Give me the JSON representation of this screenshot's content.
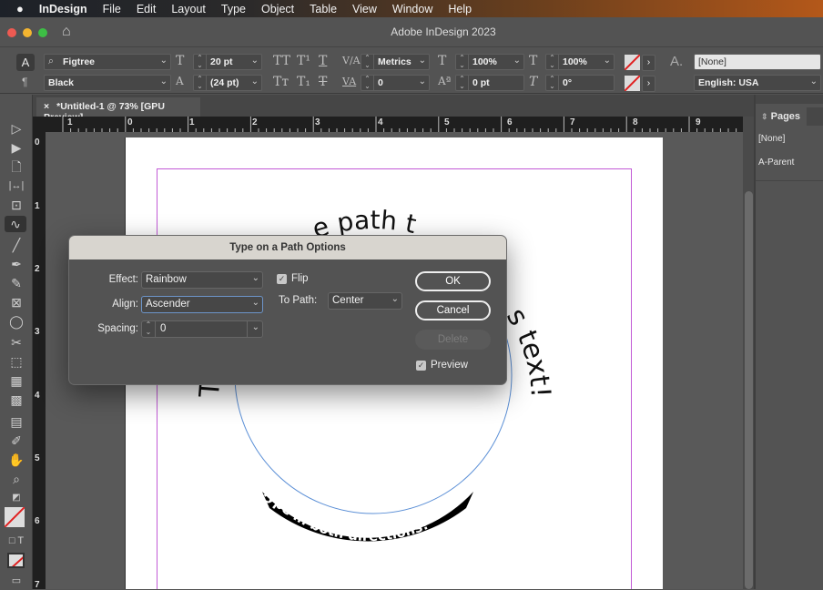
{
  "menubar": {
    "apple": "",
    "app": "InDesign",
    "items": [
      "File",
      "Edit",
      "Layout",
      "Type",
      "Object",
      "Table",
      "View",
      "Window",
      "Help"
    ]
  },
  "window": {
    "title": "Adobe InDesign 2023"
  },
  "control": {
    "font_family": "Figtree",
    "font_style": "Black",
    "font_size": "20 pt",
    "leading": "(24 pt)",
    "kerning": "Metrics",
    "tracking": "0",
    "vertical_scale": "100%",
    "horizontal_scale": "100%",
    "baseline_shift": "0 pt",
    "skew": "0°",
    "char_style": "[None]",
    "language": "English: USA",
    "caps": "TT",
    "superscript": "T¹",
    "underline": "T",
    "small_caps": "Tт",
    "subscript": "T₁",
    "strike": "T",
    "char_mode": "A",
    "para_mode": "¶",
    "style_icon": "A."
  },
  "document": {
    "tab": "*Untitled-1 @ 73% [GPU Preview]",
    "close": "×"
  },
  "ruler": {
    "h": [
      "1",
      "0",
      "1",
      "2",
      "3",
      "4",
      "5",
      "6",
      "7",
      "8",
      "9"
    ],
    "v": [
      "0",
      "1",
      "2",
      "3",
      "4",
      "5",
      "6",
      "7"
    ]
  },
  "canvas": {
    "top_fragments": [
      "T",
      "e path t",
      "s text!"
    ],
    "bottom_text": "Type in both directions!"
  },
  "pages_panel": {
    "title": "Pages",
    "items": [
      "[None]",
      "A-Parent"
    ]
  },
  "dialog": {
    "title": "Type on a Path Options",
    "effect_label": "Effect:",
    "effect": "Rainbow",
    "align_label": "Align:",
    "align": "Ascender",
    "spacing_label": "Spacing:",
    "spacing": "0",
    "flip_label": "Flip",
    "flip": true,
    "to_path_label": "To Path:",
    "to_path": "Center",
    "ok": "OK",
    "cancel": "Cancel",
    "delete": "Delete",
    "preview_label": "Preview",
    "preview": true
  }
}
